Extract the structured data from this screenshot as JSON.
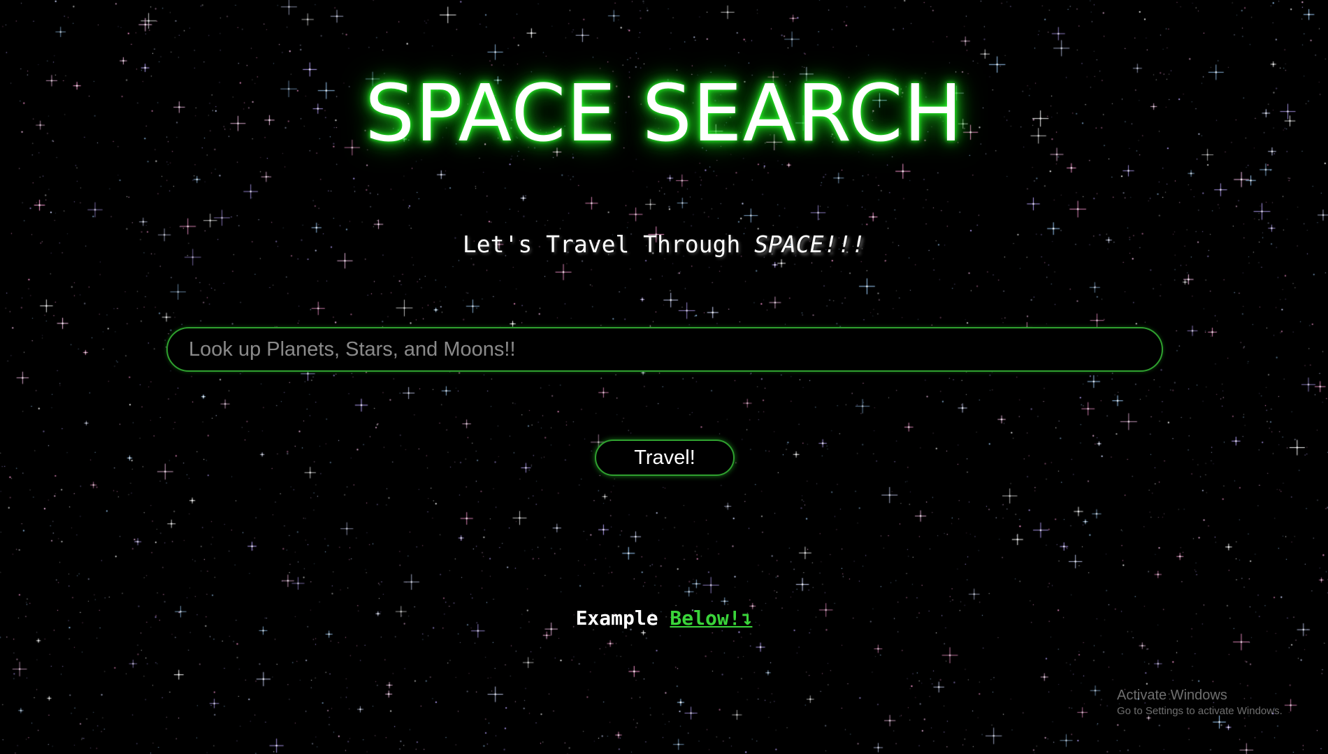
{
  "page": {
    "title": "SPACE SEARCH",
    "subtitle_prefix": "Let's Travel Through ",
    "subtitle_emphasis": "SPACE!!!"
  },
  "search": {
    "placeholder": "Look up Planets, Stars, and Moons!!",
    "value": ""
  },
  "travel_button": {
    "label": "Travel!"
  },
  "example": {
    "prefix": "Example ",
    "link_label": "Below!↴"
  },
  "watermark": {
    "title": "Activate Windows",
    "subtitle": "Go to Settings to activate Windows."
  },
  "colors": {
    "background": "#000000",
    "accent_green": "#2fa02f",
    "glow_green": "#22dd22",
    "link_green": "#3ad43a",
    "text": "#ffffff"
  },
  "icons": {
    "link_arrow": "arrow-down-right-icon"
  }
}
